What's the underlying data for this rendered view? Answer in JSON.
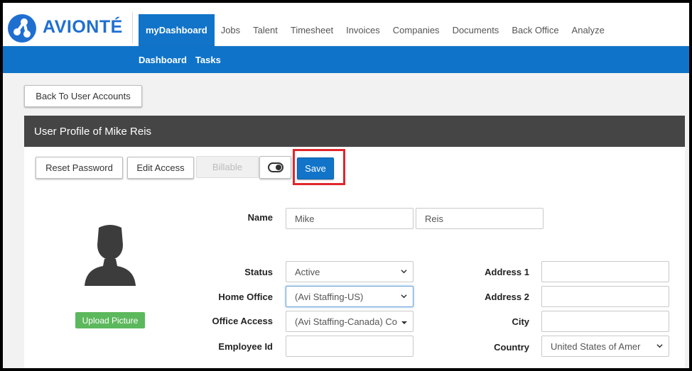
{
  "app": {
    "brand": "AVIONTÉ"
  },
  "nav": {
    "items": [
      "myDashboard",
      "Jobs",
      "Talent",
      "Timesheet",
      "Invoices",
      "Companies",
      "Documents",
      "Back Office",
      "Analyze"
    ],
    "active_index": 0
  },
  "subnav": {
    "items": [
      "Dashboard",
      "Tasks"
    ]
  },
  "toolbar": {
    "back_label": "Back To User Accounts"
  },
  "panel": {
    "title": "User Profile of Mike Reis"
  },
  "actions": {
    "reset_password": "Reset Password",
    "edit_access": "Edit Access",
    "billable": "Billable",
    "save": "Save"
  },
  "profile": {
    "upload_label": "Upload Picture",
    "name_label": "Name",
    "first_name": "Mike",
    "last_name": "Reis",
    "status_label": "Status",
    "status_value": "Active",
    "home_office_label": "Home Office",
    "home_office_value": "(Avi Staffing-US)",
    "office_access_label": "Office Access",
    "office_access_value": "(Avi Staffing-Canada) Co",
    "employee_id_label": "Employee Id",
    "employee_id_value": "",
    "address1_label": "Address 1",
    "address1_value": "",
    "address2_label": "Address 2",
    "address2_value": "",
    "city_label": "City",
    "city_value": "",
    "country_label": "Country",
    "country_value": "United States of Amer"
  },
  "colors": {
    "brand_blue": "#1274c8",
    "header_dark": "#454545",
    "upload_green": "#5cb85c",
    "highlight_red": "#e0262c"
  }
}
